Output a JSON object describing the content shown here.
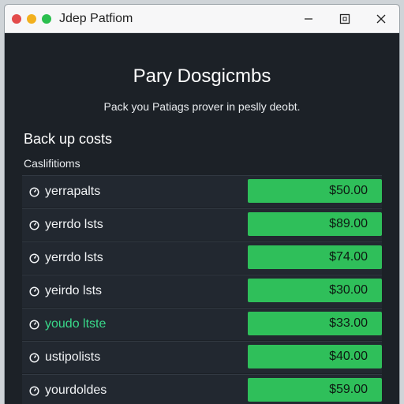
{
  "window": {
    "title": "Jdep Patfiom",
    "traffic_lights": [
      "#e34b4b",
      "#f2b01e",
      "#2bbf4e"
    ],
    "controls": [
      "minimize-icon",
      "maximize-icon",
      "close-icon"
    ]
  },
  "main": {
    "heading": "Pary Dosgicmbs",
    "subheading": "Pack you Patiags prover in peslly deobt.",
    "section_title": "Back up costs",
    "column_label": "Caslifitioms",
    "rows": [
      {
        "icon": "clock-icon",
        "label": "yerrapalts",
        "cost": "$50.00"
      },
      {
        "icon": "clock-icon",
        "label": "yerrdo lsts",
        "cost": "$89.00"
      },
      {
        "icon": "clock-icon",
        "label": "yerrdo lsts",
        "cost": "$74.00"
      },
      {
        "icon": "clock-icon",
        "label": "yeirdo lsts",
        "cost": "$30.00"
      },
      {
        "icon": "clock-icon",
        "label": "youdo ltste",
        "cost": "$33.00",
        "highlighted": true
      },
      {
        "icon": "clock-icon",
        "label": "ustipolists",
        "cost": "$40.00"
      },
      {
        "icon": "clock-icon",
        "label": "yourdoldes",
        "cost": "$59.00"
      }
    ]
  },
  "colors": {
    "window_bg": "#1c2127",
    "accent_green": "#2fbf5a",
    "highlight_text": "#39d98a"
  }
}
